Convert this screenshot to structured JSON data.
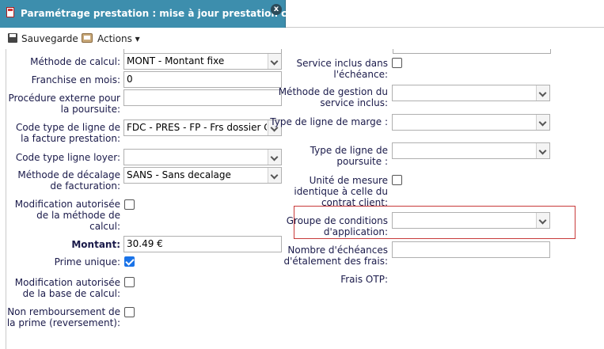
{
  "tab": {
    "title": "Paramétrage prestation : mise à jour prestation client",
    "close": "x"
  },
  "toolbar": {
    "save_label": "Sauvegarde",
    "actions_label": "Actions ▾"
  },
  "left": {
    "methode_calcul": {
      "label": "Méthode de calcul:",
      "value": "MONT - Montant fixe"
    },
    "franchise": {
      "label": "Franchise en mois:",
      "value": "0"
    },
    "procedure": {
      "label1": "Procédure externe pour",
      "label2": "la poursuite:",
      "value": ""
    },
    "code_type_ligne": {
      "label1": "Code type de ligne de",
      "label2": "la facture prestation:",
      "value": "FDC - PRES - FP - Frs dossier CRI"
    },
    "code_type_loyer": {
      "label": "Code type ligne loyer:",
      "value": ""
    },
    "methode_decalage": {
      "label1": "Méthode de décalage",
      "label2": "de facturation:",
      "value": "SANS - Sans decalage"
    },
    "modif_methode": {
      "label1": "Modification autorisée",
      "label2": "de la méthode de",
      "label3": "calcul:",
      "checked": false
    },
    "montant": {
      "label": "Montant:",
      "value": "30.49 €"
    },
    "prime_unique": {
      "label": "Prime unique:",
      "checked": true
    },
    "modif_base": {
      "label1": "Modification autorisée",
      "label2": "de la base de calcul:",
      "checked": false
    },
    "non_remboursement": {
      "label1": "Non remboursement de",
      "label2": "la prime (reversement):",
      "checked": false
    }
  },
  "right": {
    "service_inclus": {
      "label1": "Service inclus dans",
      "label2": "l'échéance:",
      "checked": false
    },
    "methode_gestion": {
      "label1": "Méthode de gestion du",
      "label2": "service inclus:",
      "value": ""
    },
    "type_ligne_marge": {
      "label": "Type de ligne de marge :",
      "value": ""
    },
    "type_ligne_poursuite": {
      "label1": "Type de ligne de",
      "label2": "poursuite :",
      "value": ""
    },
    "unite_mesure": {
      "label1": "Unité de mesure",
      "label2": "identique à celle du",
      "label3": "contrat client:",
      "checked": false
    },
    "groupe_conditions": {
      "label1": "Groupe de conditions",
      "label2": "d'application:",
      "value": ""
    },
    "nombre_echeances": {
      "label1": "Nombre d'échéances",
      "label2": "d'étalement des frais:",
      "value": ""
    },
    "frais_otp": {
      "label": "Frais OTP:"
    }
  },
  "colors": {
    "tab_bg": "#3d8ead",
    "highlight_border": "#c83a3a",
    "checkbox_on": "#1a73e8",
    "label_text": "#1a1a4a"
  }
}
